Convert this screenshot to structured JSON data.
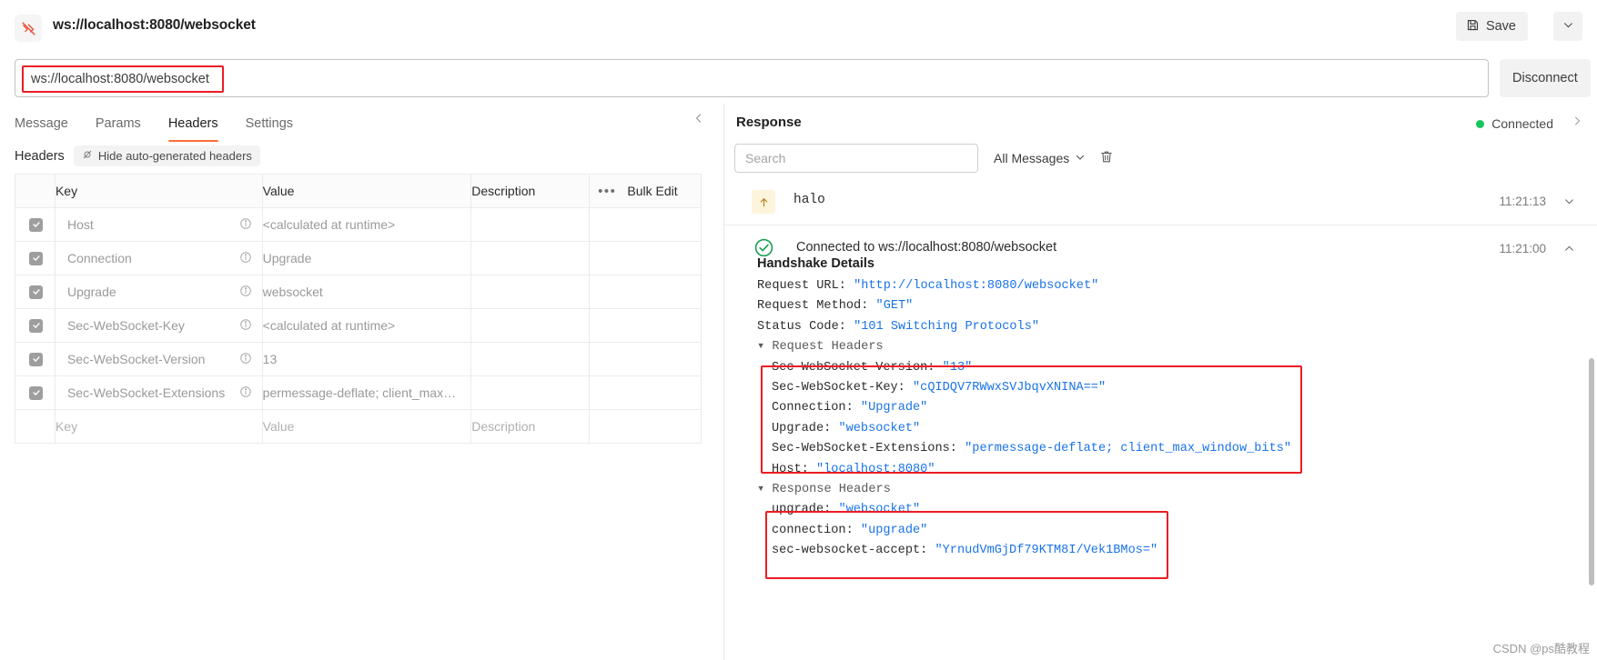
{
  "window": {
    "tab_title": "ws://localhost:8080/websocket",
    "tab_icon": "websocket-icon",
    "save_label": "Save",
    "save_icon": "floppy-disk-icon",
    "save_caret_icon": "chevron-down-icon"
  },
  "url_bar": {
    "value": "ws://localhost:8080/websocket",
    "connect_label": "Disconnect"
  },
  "left": {
    "tabs": [
      {
        "label": "Message",
        "active": false
      },
      {
        "label": "Params",
        "active": false
      },
      {
        "label": "Headers",
        "active": true
      },
      {
        "label": "Settings",
        "active": false
      }
    ],
    "collapse_icon": "chevron-left-icon",
    "headers_label": "Headers",
    "hide_auto_label": "Hide auto-generated headers",
    "hide_auto_icon": "eye-slash-icon",
    "table": {
      "columns": [
        "",
        "Key",
        "Value",
        "Description",
        ""
      ],
      "more_icon": "ellipsis-icon",
      "bulk_edit_label": "Bulk Edit",
      "rows": [
        {
          "checked": true,
          "key": "Host",
          "value": "<calculated at runtime>",
          "description": "",
          "info_icon": "info-icon"
        },
        {
          "checked": true,
          "key": "Connection",
          "value": "Upgrade",
          "description": "",
          "info_icon": "info-icon"
        },
        {
          "checked": true,
          "key": "Upgrade",
          "value": "websocket",
          "description": "",
          "info_icon": "info-icon"
        },
        {
          "checked": true,
          "key": "Sec-WebSocket-Key",
          "value": "<calculated at runtime>",
          "description": "",
          "info_icon": "info-icon"
        },
        {
          "checked": true,
          "key": "Sec-WebSocket-Version",
          "value": "13",
          "description": "",
          "info_icon": "info-icon"
        },
        {
          "checked": true,
          "key": "Sec-WebSocket-Extensions",
          "value": "permessage-deflate; client_max…",
          "description": "",
          "info_icon": "info-icon"
        }
      ],
      "new_row": {
        "key": "Key",
        "value": "Value",
        "description": "Description"
      }
    }
  },
  "right": {
    "title": "Response",
    "status_label": "Connected",
    "status_color": "#16c65c",
    "collapse_icon": "chevron-right-icon",
    "search_placeholder": "Search",
    "filter_label": "All Messages",
    "filter_caret_icon": "chevron-down-icon",
    "clear_icon": "trash-icon",
    "messages": [
      {
        "direction_icon": "arrow-up-icon",
        "text": "halo",
        "time": "11:21:13",
        "caret_icon": "chevron-down-icon"
      }
    ],
    "connection_event": {
      "status_icon": "check-circle-icon",
      "text": "Connected to ws://localhost:8080/websocket",
      "time": "11:21:00",
      "caret_icon": "chevron-up-icon"
    },
    "handshake": {
      "title": "Handshake Details",
      "request_url_key": "Request URL:",
      "request_url_value": "\"http://localhost:8080/websocket\"",
      "request_method_key": "Request Method:",
      "request_method_value": "\"GET\"",
      "status_code_key": "Status Code:",
      "status_code_value": "\"101 Switching Protocols\"",
      "request_headers_label": "▾ Request Headers",
      "request_headers": [
        {
          "key": "Sec-WebSocket-Version:",
          "value": "\"13\""
        },
        {
          "key": "Sec-WebSocket-Key:",
          "value": "\"cQIDQV7RWwxSVJbqvXNINA==\""
        },
        {
          "key": "Connection:",
          "value": "\"Upgrade\""
        },
        {
          "key": "Upgrade:",
          "value": "\"websocket\""
        },
        {
          "key": "Sec-WebSocket-Extensions:",
          "value": "\"permessage-deflate; client_max_window_bits\""
        },
        {
          "key": "Host:",
          "value": "\"localhost:8080\""
        }
      ],
      "response_headers_label": "▾ Response Headers",
      "response_headers": [
        {
          "key": "upgrade:",
          "value": "\"websocket\""
        },
        {
          "key": "connection:",
          "value": "\"upgrade\""
        },
        {
          "key": "sec-websocket-accept:",
          "value": "\"YrnudVmGjDf79KTM8I/Vek1BMos=\""
        }
      ]
    }
  },
  "watermark": "CSDN @ps酷教程",
  "accent": "#ff6c37",
  "highlight": "#ec1c24"
}
